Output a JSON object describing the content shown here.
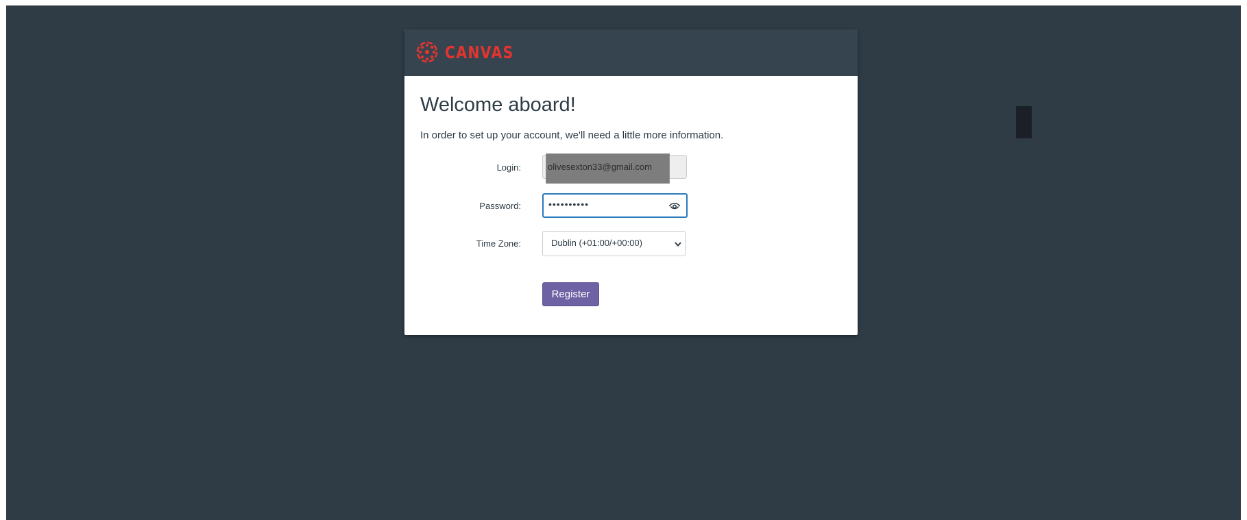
{
  "brand": {
    "name": "CANVAS",
    "color": "#e3342f",
    "logo_icon": "canvas-logo-icon"
  },
  "page": {
    "title": "Welcome aboard!",
    "intro": "In order to set up your account, we'll need a little more information."
  },
  "form": {
    "login_label": "Login:",
    "login_value": "olivesexton33@gmail.com",
    "password_label": "Password:",
    "password_masked": "••••••••••",
    "password_toggle_icon": "eye-icon",
    "timezone_label": "Time Zone:",
    "timezone_value": "Dublin (+01:00/+00:00)",
    "register_label": "Register"
  },
  "colors": {
    "background": "#2f3b45",
    "header": "#35444f",
    "button": "#6f62a4",
    "focus": "#2b7abc"
  }
}
